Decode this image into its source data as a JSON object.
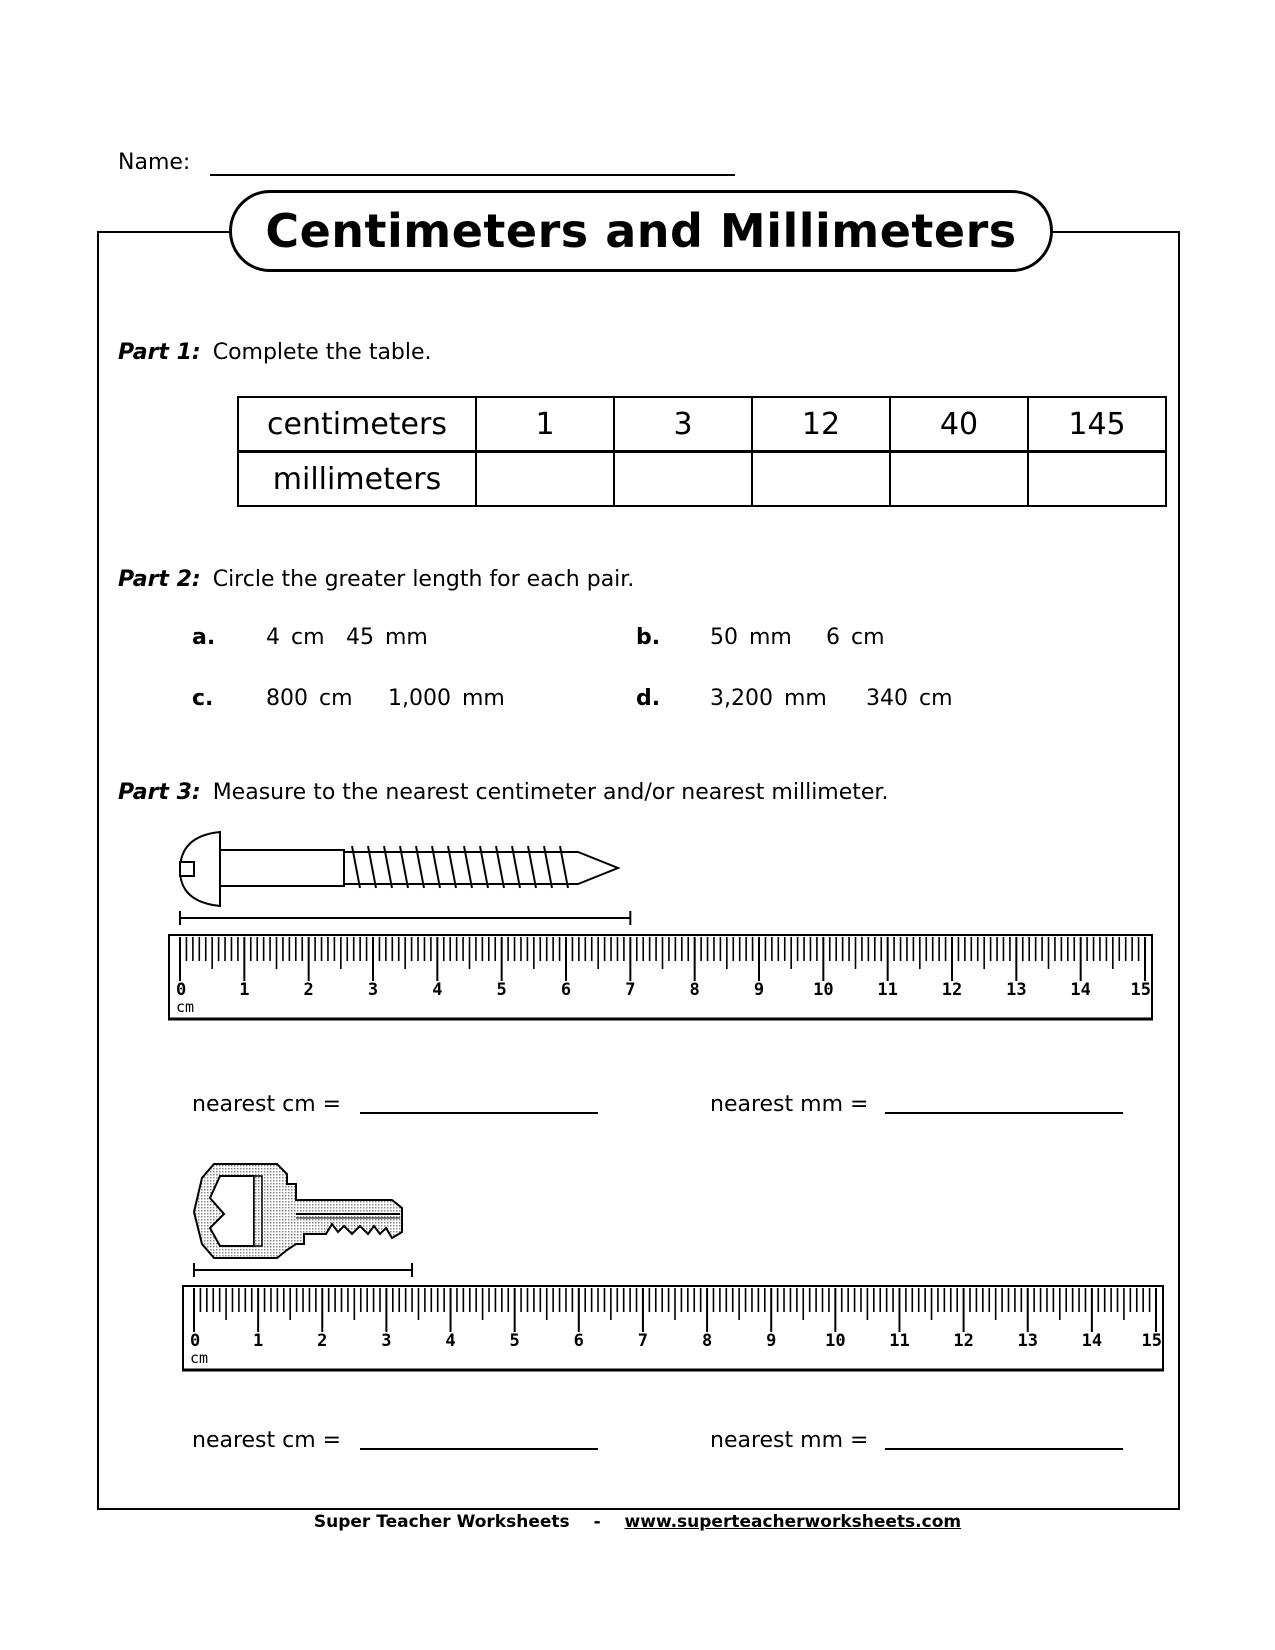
{
  "header": {
    "name_label": "Name:",
    "title": "Centimeters and Millimeters"
  },
  "part1": {
    "label": "Part 1:",
    "instruction": "Complete the table.",
    "table": {
      "row_headers": [
        "centimeters",
        "millimeters"
      ],
      "centimeters": [
        "1",
        "3",
        "12",
        "40",
        "145"
      ],
      "millimeters": [
        "",
        "",
        "",
        "",
        ""
      ]
    }
  },
  "part2": {
    "label": "Part 2:",
    "instruction": "Circle the greater length for each pair.",
    "pairs": [
      {
        "letter": "a.",
        "first": "4 cm",
        "second": "45 mm"
      },
      {
        "letter": "b.",
        "first": "50 mm",
        "second": "6 cm"
      },
      {
        "letter": "c.",
        "first": "800 cm",
        "second": "1,000 mm"
      },
      {
        "letter": "d.",
        "first": "3,200 mm",
        "second": "340 cm"
      }
    ]
  },
  "part3": {
    "label": "Part 3:",
    "instruction": "Measure to the nearest centimeter and/or nearest millimeter.",
    "items": [
      {
        "object": "screw",
        "measured_length_cm": 7,
        "ruler": {
          "unit_label": "cm",
          "ticks": [
            "0",
            "1",
            "2",
            "3",
            "4",
            "5",
            "6",
            "7",
            "8",
            "9",
            "10",
            "11",
            "12",
            "13",
            "14",
            "15"
          ]
        },
        "answer_cm_label": "nearest cm =",
        "answer_mm_label": "nearest mm ="
      },
      {
        "object": "key",
        "measured_length_cm": 3.4,
        "ruler": {
          "unit_label": "cm",
          "ticks": [
            "0",
            "1",
            "2",
            "3",
            "4",
            "5",
            "6",
            "7",
            "8",
            "9",
            "10",
            "11",
            "12",
            "13",
            "14",
            "15"
          ]
        },
        "answer_cm_label": "nearest cm =",
        "answer_mm_label": "nearest mm ="
      }
    ]
  },
  "footer": {
    "brand": "Super Teacher Worksheets",
    "separator": "-",
    "url": "www.superteacherworksheets.com"
  }
}
